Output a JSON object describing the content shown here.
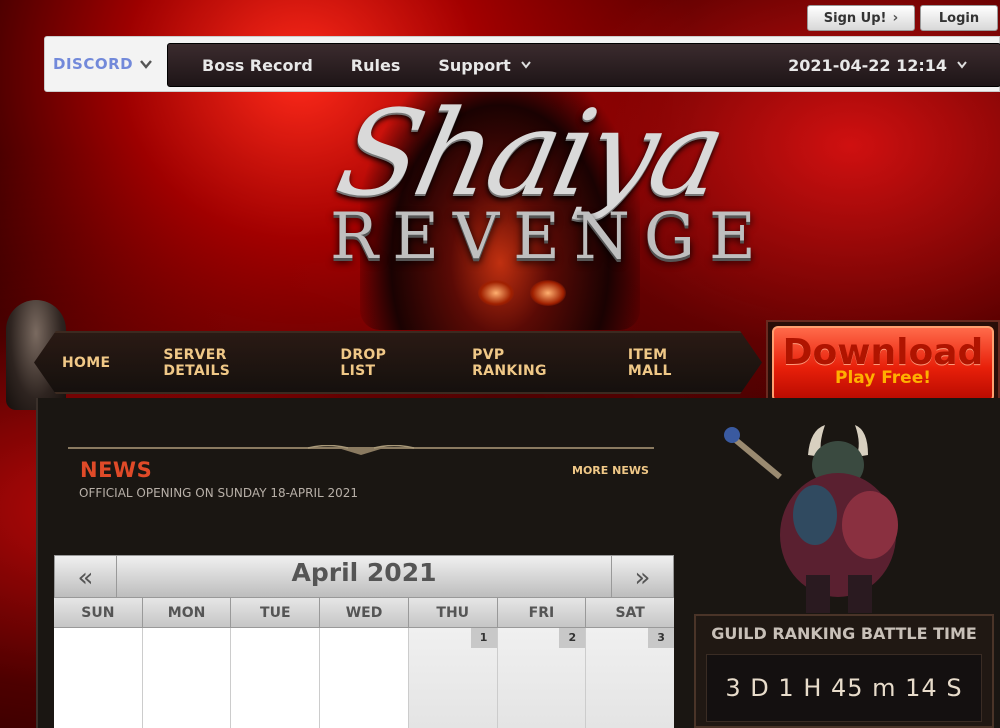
{
  "auth": {
    "signup_label": "Sign Up!",
    "login_label": "Login"
  },
  "topnav": {
    "discord_label": "DISCORD",
    "items": [
      "Boss Record",
      "Rules",
      "Support"
    ],
    "datetime": "2021-04-22 12:14"
  },
  "logo": {
    "line1": "Shaiya",
    "line2": "REVENGE"
  },
  "mainmenu": {
    "items": [
      "HOME",
      "SERVER DETAILS",
      "DROP LIST",
      "PVP RANKING",
      "ITEM MALL"
    ]
  },
  "download": {
    "title": "Download",
    "subtitle": "Play Free!"
  },
  "news": {
    "heading": "NEWS",
    "more_label": "MORE NEWS",
    "items": [
      "OFFICIAL OPENING ON SUNDAY 18-APRIL 2021"
    ]
  },
  "calendar": {
    "title": "April 2021",
    "prev_glyph": "«",
    "next_glyph": "»",
    "weekdays": [
      "SUN",
      "MON",
      "TUE",
      "WED",
      "THU",
      "FRI",
      "SAT"
    ],
    "first_week": [
      "",
      "",
      "",
      "",
      "1",
      "2",
      "3"
    ]
  },
  "guild": {
    "title": "GUILD RANKING BATTLE TIME",
    "countdown": "3 D 1 H 45 m 14 S"
  },
  "colors": {
    "accent": "#e04a28",
    "menu_text": "#f0c887",
    "discord": "#7289da",
    "download": "#e8200a"
  }
}
